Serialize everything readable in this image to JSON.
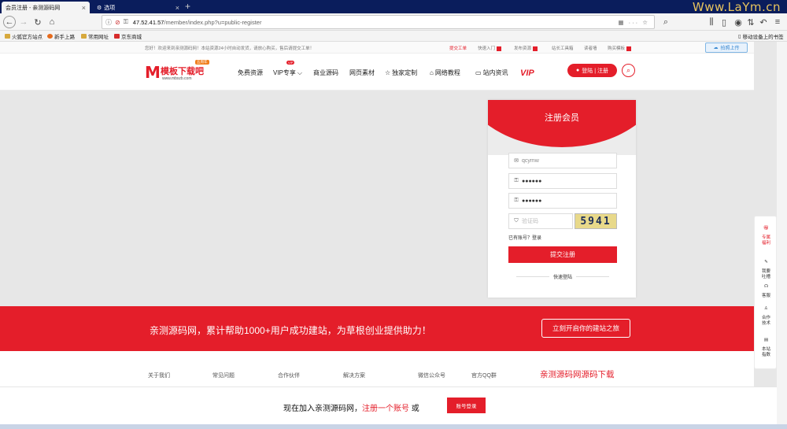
{
  "browser": {
    "tabs": [
      {
        "label": "会员注册 - 亲测源码网",
        "active": true
      },
      {
        "label": "选项",
        "active": false
      }
    ],
    "watermark": "Www.LaYm.cn",
    "url_host": "47.52.41.57",
    "url_path": "/member/index.php?u=public-register",
    "bookmarks": [
      "火狐官方站点",
      "新手上路",
      "常用网址",
      "京东商城"
    ],
    "mobile_bookmarks": "移动设备上的书签"
  },
  "site": {
    "top_notice": "您好！欢迎来到亲测源码网！本站资源24小时自动发货，请放心购买，售后请提交工单！",
    "top_links": [
      "提交工单",
      "快速入门",
      "发布资源",
      "站长工具箱",
      "读者墙",
      "购买模板"
    ],
    "upload_label": "拍照上传",
    "logo_text": "模板下载吧",
    "logo_sub": "www.mbxzb.com",
    "logo_badge": "五周年",
    "nav": [
      "免费资源",
      "VIP专享",
      "商业源码",
      "网页素材",
      "独家定制",
      "网络教程",
      "站内资讯"
    ],
    "vip_badge": "VIP",
    "vip_logo": "VIP",
    "login_label": "登陆 | 注册"
  },
  "register": {
    "title": "注册会员",
    "username": "qcymw",
    "password": "●●●●●●",
    "password_confirm": "●●●●●●",
    "captcha_placeholder": "验证码",
    "captcha_text": "5941",
    "have_account": "已有账号？登录",
    "submit": "提交注册",
    "quick_login": "快速登陆"
  },
  "banner": {
    "text": "亲测源码网，累计帮助1000+用户成功建站，为草根创业提供助力！",
    "button": "立刻开启你的建站之旅"
  },
  "footer": {
    "cols": [
      "关于我们",
      "常见问题",
      "合作伙伴",
      "解决方案",
      "微信公众号",
      "官方QQ群"
    ],
    "brand": "亲测源码网源码下载"
  },
  "join": {
    "text_a": "现在加入亲测源码网，",
    "text_red": "注册一个账号",
    "text_b": " 或",
    "button": "账号登录"
  },
  "rightbar": [
    {
      "label": "专属\n福利"
    },
    {
      "label": "我要\n吐槽"
    },
    {
      "label": "客服"
    },
    {
      "label": "合作\n技术"
    },
    {
      "label": "本站\n指数"
    }
  ],
  "colors": {
    "brand_red": "#e41e2a",
    "browser_tab_bg": "#0a1d5c"
  }
}
